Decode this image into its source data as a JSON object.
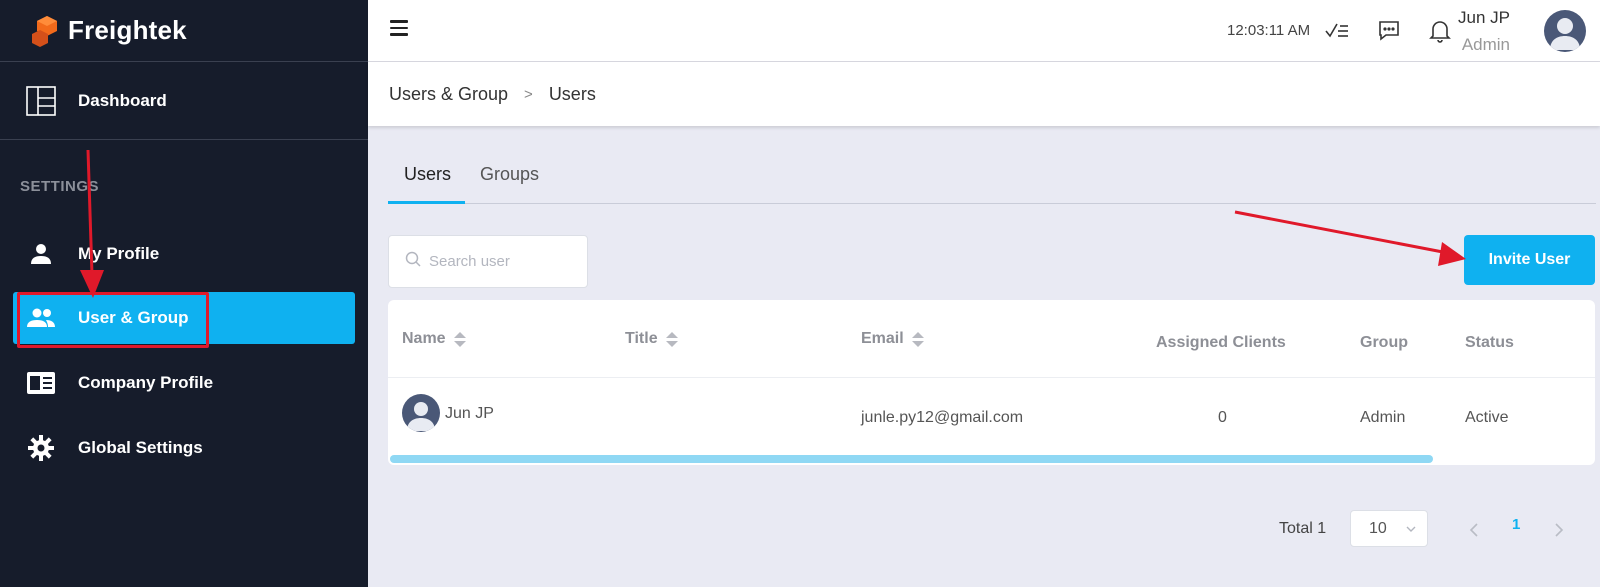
{
  "app": {
    "brand": "Freightek"
  },
  "sidebar": {
    "dashboard": "Dashboard",
    "section_title": "SETTINGS",
    "items": [
      {
        "label": "My Profile",
        "icon": "user-icon"
      },
      {
        "label": "User & Group",
        "icon": "users-icon",
        "active": true
      },
      {
        "label": "Company Profile",
        "icon": "id-card-icon"
      },
      {
        "label": "Global Settings",
        "icon": "gear-icon"
      }
    ]
  },
  "topbar": {
    "time": "12:03:11 AM",
    "user_name": "Jun JP",
    "user_role": "Admin"
  },
  "breadcrumb": {
    "parent": "Users & Group",
    "separator": ">",
    "current": "Users"
  },
  "tabs": [
    {
      "label": "Users",
      "active": true
    },
    {
      "label": "Groups",
      "active": false
    }
  ],
  "search": {
    "placeholder": "Search user",
    "value": ""
  },
  "invite_button": "Invite User",
  "table": {
    "columns": [
      "Name",
      "Title",
      "Email",
      "Assigned Clients",
      "Group",
      "Status"
    ],
    "rows": [
      {
        "name": "Jun JP",
        "title": "",
        "email": "junle.py12@gmail.com",
        "assigned_clients": "0",
        "group": "Admin",
        "status": "Active"
      }
    ]
  },
  "pagination": {
    "total_label": "Total 1",
    "page_size": "10",
    "current_page": "1"
  },
  "colors": {
    "accent": "#0fb1f0",
    "sidebar_bg": "#161c2b",
    "annotation": "#e0192a"
  }
}
